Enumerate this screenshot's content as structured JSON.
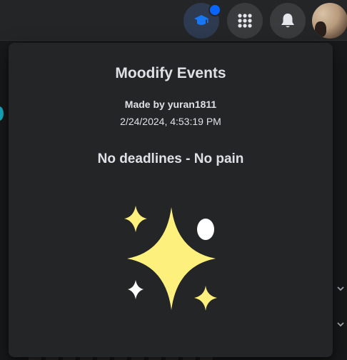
{
  "header": {
    "buttons": [
      {
        "name": "extension-button",
        "icon": "graduation-cap-icon",
        "badge": "notification-dot"
      },
      {
        "name": "menu-button",
        "icon": "grid-menu-icon"
      },
      {
        "name": "notifications-button",
        "icon": "bell-icon"
      },
      {
        "name": "profile-avatar",
        "icon": "avatar"
      }
    ]
  },
  "popup": {
    "title": "Moodify Events",
    "author": "Made by yuran1811",
    "timestamp": "2/24/2024, 4:53:19 PM",
    "message": "No deadlines - No pain",
    "illustration": "sparkles-icon"
  },
  "colors": {
    "topbar": "#242526",
    "popup_bg": "#242526",
    "page_bg": "#18191a",
    "accent_blue": "#0866ff",
    "sparkle_yellow": "#fdf07c",
    "text": "#dfe1e6"
  }
}
